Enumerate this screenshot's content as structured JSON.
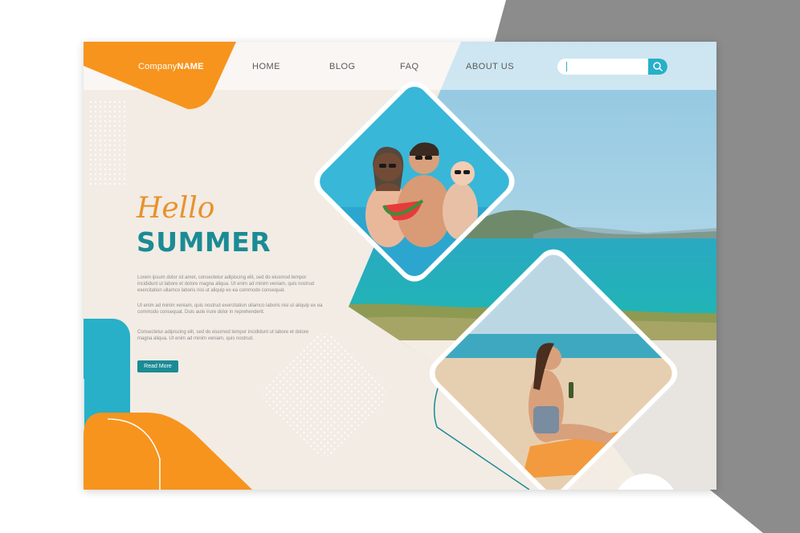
{
  "header": {
    "brand_company": "Company",
    "brand_name": "NAME",
    "nav": [
      "HOME",
      "BLOG",
      "FAQ",
      "ABOUT US"
    ]
  },
  "search": {
    "value": "",
    "placeholder": ""
  },
  "hero": {
    "hello": "Hello",
    "title": "SUMMER",
    "paragraphs": [
      "Lorem ipsum dolor sit amet, consectetur adipiscing elit, sed do eiusmod tempor incididunt ut labore et dolore magna aliqua. Ut enim ad minim veniam, quis nostrud exercitation ullamco laboris nisi ut aliquip ex ea commodo consequat.",
      "Ut enim ad minim veniam, quis nostrud exercitation ullamco laboris nisi ut aliquip ex ea commodo consequat. Duis aute irure dolor in reprehenderit.",
      "Consectetur adipiscing elit, sed do eiusmod tempor incididunt ut labore et dolore magna aliqua. Ut enim ad minim veniam, quis nostrud."
    ],
    "button": "Read More"
  },
  "colors": {
    "orange": "#f7941d",
    "teal": "#1b8b95",
    "cyan": "#27b0c8",
    "cream": "#f2ece4",
    "gray": "#8c8c8c"
  },
  "icons": [
    "search-icon"
  ]
}
